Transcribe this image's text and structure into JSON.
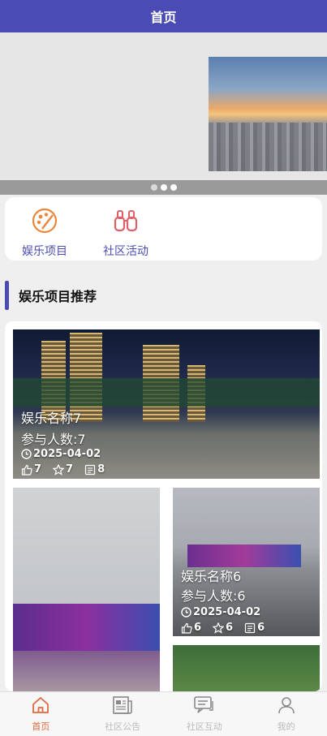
{
  "header": {
    "title": "首页"
  },
  "banner": {
    "slide_count": 3,
    "active_index": 0
  },
  "nav": [
    {
      "label": "娱乐项目",
      "icon": "palette-icon"
    },
    {
      "label": "社区活动",
      "icon": "binoculars-icon"
    }
  ],
  "section": {
    "title": "娱乐项目推荐"
  },
  "items": [
    {
      "name": "娱乐名称7",
      "participants": "参与人数:7",
      "date": "2025-04-02",
      "likes": "7",
      "stars": "7",
      "comments": "8"
    },
    {
      "name": "娱乐名称6",
      "participants": "参与人数:6",
      "date": "2025-04-02",
      "likes": "6",
      "stars": "6",
      "comments": "6"
    }
  ],
  "tabbar": [
    {
      "label": "首页",
      "icon": "home-icon",
      "active": true
    },
    {
      "label": "社区公告",
      "icon": "newspaper-icon",
      "active": false
    },
    {
      "label": "社区互动",
      "icon": "chat-icon",
      "active": false
    },
    {
      "label": "我的",
      "icon": "user-icon",
      "active": false
    }
  ],
  "colors": {
    "primary": "#4a4cb4",
    "tab_active": "#e06a3f",
    "nav_icon": "#e9873a"
  }
}
